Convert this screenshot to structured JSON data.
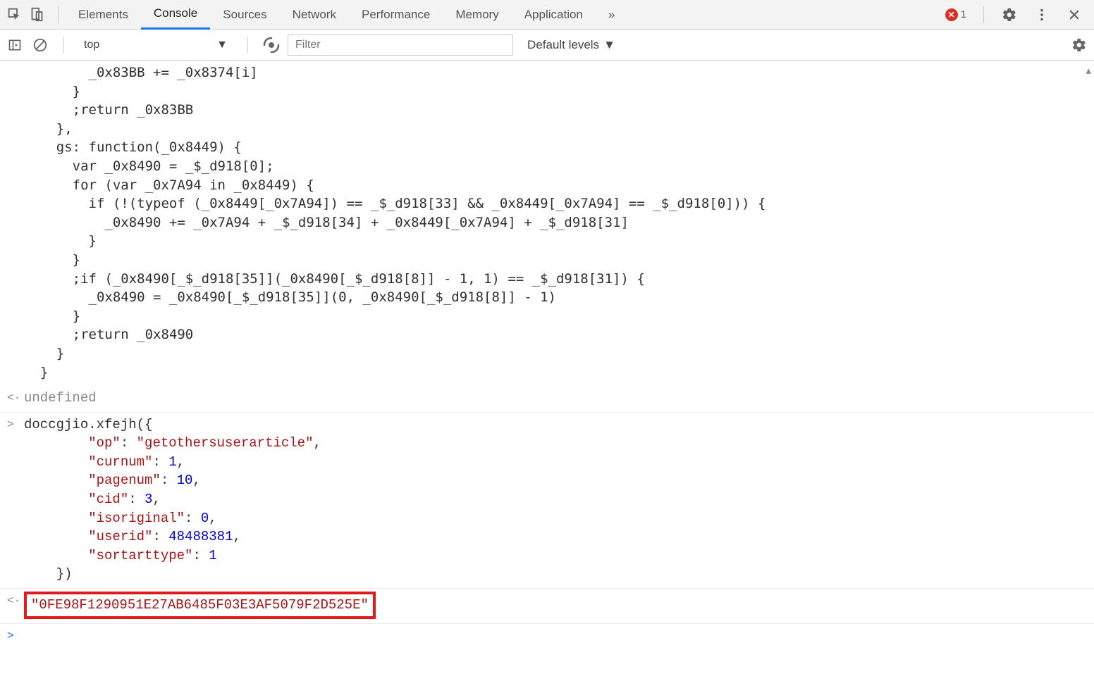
{
  "toolbar": {
    "tabs": [
      "Elements",
      "Console",
      "Sources",
      "Network",
      "Performance",
      "Memory",
      "Application"
    ],
    "active_tab": "Console",
    "more_tabs_glyph": "»",
    "error_count": "1"
  },
  "subbar": {
    "context": "top",
    "filter_placeholder": "Filter",
    "levels_label": "Default levels"
  },
  "console": {
    "code_block": "        _0x83BB += _0x8374[i]\n      }\n      ;return _0x83BB\n    },\n    gs: function(_0x8449) {\n      var _0x8490 = _$_d918[0];\n      for (var _0x7A94 in _0x8449) {\n        if (!(typeof (_0x8449[_0x7A94]) == _$_d918[33] && _0x8449[_0x7A94] == _$_d918[0])) {\n          _0x8490 += _0x7A94 + _$_d918[34] + _0x8449[_0x7A94] + _$_d918[31]\n        }\n      }\n      ;if (_0x8490[_$_d918[35]](_0x8490[_$_d918[8]] - 1, 1) == _$_d918[31]) {\n        _0x8490 = _0x8490[_$_d918[35]](0, _0x8490[_$_d918[8]] - 1)\n      }\n      ;return _0x8490\n    }\n  }",
    "undefined_label": "undefined",
    "call_head": "doccgjio.xfejh({",
    "call_pairs": [
      {
        "k": "\"op\"",
        "v": "\"getothersuserarticle\"",
        "t": "str"
      },
      {
        "k": "\"curnum\"",
        "v": "1",
        "t": "num"
      },
      {
        "k": "\"pagenum\"",
        "v": "10",
        "t": "num"
      },
      {
        "k": "\"cid\"",
        "v": "3",
        "t": "num"
      },
      {
        "k": "\"isoriginal\"",
        "v": "0",
        "t": "num"
      },
      {
        "k": "\"userid\"",
        "v": "48488381",
        "t": "num"
      },
      {
        "k": "\"sortarttype\"",
        "v": "1",
        "t": "num"
      }
    ],
    "call_tail": "    })",
    "result_string": "\"0FE98F1290951E27AB6485F03E3AF5079F2D525E\""
  }
}
